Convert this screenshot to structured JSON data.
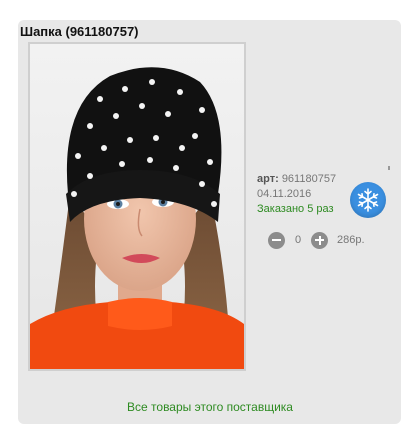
{
  "product": {
    "title": "Шапка (961180757)",
    "art_label": "арт:",
    "art_value": "961180757",
    "date": "04.11.2016",
    "ordered_text": "Заказано 5 раз",
    "season_icon": "snowflake-icon"
  },
  "cart": {
    "quantity": "0",
    "price": "286р."
  },
  "links": {
    "supplier": "Все товары этого поставщика"
  },
  "colors": {
    "card_bg": "#e8e8e8",
    "link_green": "#2e8b22",
    "snow_blue": "#3a8fe0"
  }
}
